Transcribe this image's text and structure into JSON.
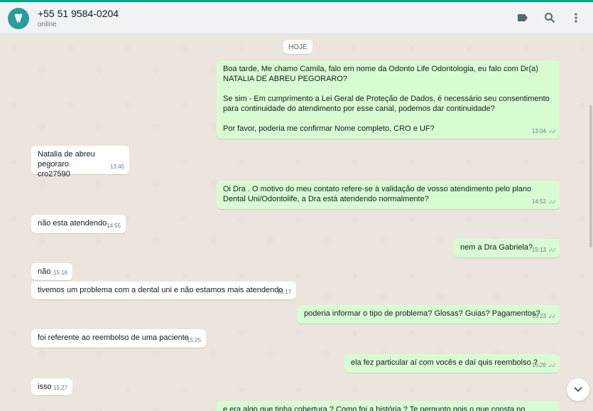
{
  "header": {
    "contact_name": "+55 51 9584-0204",
    "status": "online",
    "icons": [
      "label-icon",
      "search-icon",
      "menu-icon"
    ]
  },
  "chat": {
    "date_chip": "HOJE",
    "messages": [
      {
        "dir": "out",
        "text": "Boa tarde, Me chamo Camila, falo em nome da Odonto Life Odontologia, eu falo com Dr(a) NATALIA DE ABREU PEGORARO?\n\nSe sim - Em cumprimento a Lei Geral de Proteção de Dados, é necessário seu consentimento para continuidade do atendimento por esse canal, podemos dar continuidade?\n\nPor favor, poderia me confirmar Nome completo, CRO e UF?",
        "time": "13:04"
      },
      {
        "dir": "in",
        "text": "Natalia de abreu pegoraro\ncro27590",
        "time": "13:40"
      },
      {
        "dir": "out",
        "text": "Oi Dra . O motivo do meu contato refere-se à validação de vosso atendimento pelo plano Dental Uni/Odontolife, a Dra está atendendo normalmente?",
        "time": "14:52"
      },
      {
        "dir": "in",
        "text": "não esta atendendo",
        "time": "14:55"
      },
      {
        "dir": "out",
        "text": "nem a Dra Gabriela?",
        "time": "15:13"
      },
      {
        "dir": "in",
        "text": "não",
        "time": "15:16"
      },
      {
        "dir": "in",
        "text": "tivemos um problema com a dental uni e não estamos mais atendendo",
        "time": "15:17"
      },
      {
        "dir": "out",
        "text": "poderia informar o tipo de problema? Glosas? Guias? Pagamentos?",
        "time": "15:23"
      },
      {
        "dir": "in",
        "text": "foi referente ao reembolso de uma paciente",
        "time": "15:25"
      },
      {
        "dir": "out",
        "text": "ela fez particular aí com vocês e daí quis reembolso ?",
        "time": "15:26"
      },
      {
        "dir": "in",
        "text": "isso",
        "time": "15:27"
      },
      {
        "dir": "out",
        "text": "e era algo que tinha cobertura ? Como foi a história ? Te pergunto pois o que consta no protocolo",
        "time": ""
      }
    ]
  },
  "colors": {
    "accent": "#00a884",
    "outgoing_bubble": "#d9fdd3",
    "incoming_bubble": "#ffffff",
    "chat_background": "#ece5dd"
  }
}
